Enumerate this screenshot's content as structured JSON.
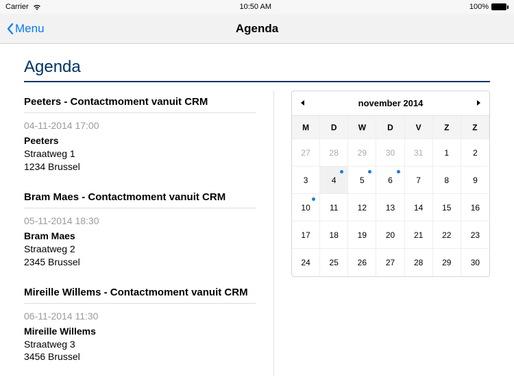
{
  "status": {
    "carrier": "Carrier",
    "time": "10:50 AM",
    "battery": "100%"
  },
  "nav": {
    "back_label": "Menu",
    "title": "Agenda"
  },
  "page": {
    "title": "Agenda"
  },
  "items": [
    {
      "title": "Peeters - Contactmoment vanuit CRM",
      "datetime": "04-11-2014 17:00",
      "name": "Peeters",
      "addr1": "Straatweg 1",
      "addr2": "1234 Brussel"
    },
    {
      "title": "Bram Maes - Contactmoment vanuit CRM",
      "datetime": "05-11-2014 18:30",
      "name": "Bram Maes",
      "addr1": "Straatweg 2",
      "addr2": "2345 Brussel"
    },
    {
      "title": "Mireille Willems - Contactmoment vanuit CRM",
      "datetime": "06-11-2014 11:30",
      "name": "Mireille Willems",
      "addr1": "Straatweg 3",
      "addr2": "3456 Brussel"
    }
  ],
  "calendar": {
    "month_label": "november 2014",
    "dow": [
      "M",
      "D",
      "W",
      "D",
      "V",
      "Z",
      "Z"
    ],
    "days": [
      {
        "n": 27,
        "other": true
      },
      {
        "n": 28,
        "other": true
      },
      {
        "n": 29,
        "other": true
      },
      {
        "n": 30,
        "other": true
      },
      {
        "n": 31,
        "other": true
      },
      {
        "n": 1
      },
      {
        "n": 2
      },
      {
        "n": 3
      },
      {
        "n": 4,
        "selected": true,
        "dot": true
      },
      {
        "n": 5,
        "dot": true
      },
      {
        "n": 6,
        "dot": true
      },
      {
        "n": 7
      },
      {
        "n": 8
      },
      {
        "n": 9
      },
      {
        "n": 10,
        "dot": true
      },
      {
        "n": 11
      },
      {
        "n": 12
      },
      {
        "n": 13
      },
      {
        "n": 14
      },
      {
        "n": 15
      },
      {
        "n": 16
      },
      {
        "n": 17
      },
      {
        "n": 18
      },
      {
        "n": 19
      },
      {
        "n": 20
      },
      {
        "n": 21
      },
      {
        "n": 22
      },
      {
        "n": 23
      },
      {
        "n": 24
      },
      {
        "n": 25
      },
      {
        "n": 26
      },
      {
        "n": 27
      },
      {
        "n": 28
      },
      {
        "n": 29
      },
      {
        "n": 30
      }
    ]
  }
}
